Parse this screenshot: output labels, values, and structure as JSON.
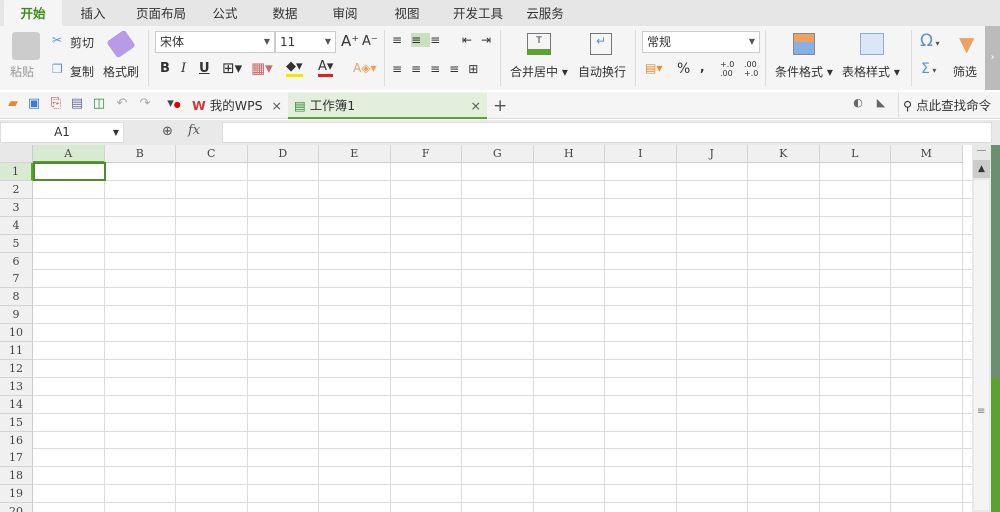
{
  "menu": [
    "开始",
    "插入",
    "页面布局",
    "公式",
    "数据",
    "审阅",
    "视图",
    "开发工具",
    "云服务"
  ],
  "ribbon": {
    "paste": "粘贴",
    "cut": "剪切",
    "copy": "复制",
    "format_painter": "格式刷",
    "font_name": "宋体",
    "font_size": "11",
    "merge_center": "合并居中",
    "wrap_text": "自动换行",
    "number_format": "常规",
    "percent": "%",
    "comma": ",",
    "cond_format": "条件格式",
    "table_style": "表格样式",
    "filter": "筛选",
    "bold": "B",
    "italic": "I",
    "underline": "U",
    "omega": "Ω",
    "sigma": "Σ",
    "font_color": "#e02020",
    "fill_color": "#f5e600",
    "accent": "#3c8d1e"
  },
  "tabs": {
    "my_wps": "我的WPS",
    "workbook": "工作簿1",
    "add": "+",
    "search": "点此查找命令"
  },
  "formula": {
    "name_box": "A1",
    "fx": "fx",
    "value": ""
  },
  "columns": [
    "A",
    "B",
    "C",
    "D",
    "E",
    "F",
    "G",
    "H",
    "I",
    "J",
    "K",
    "L",
    "M"
  ],
  "rows": [
    "1",
    "2",
    "3",
    "4",
    "5",
    "6",
    "7",
    "8",
    "9",
    "10",
    "11",
    "12",
    "13",
    "14",
    "15",
    "16",
    "17",
    "18",
    "19",
    "20"
  ],
  "selected_cell": "A1"
}
